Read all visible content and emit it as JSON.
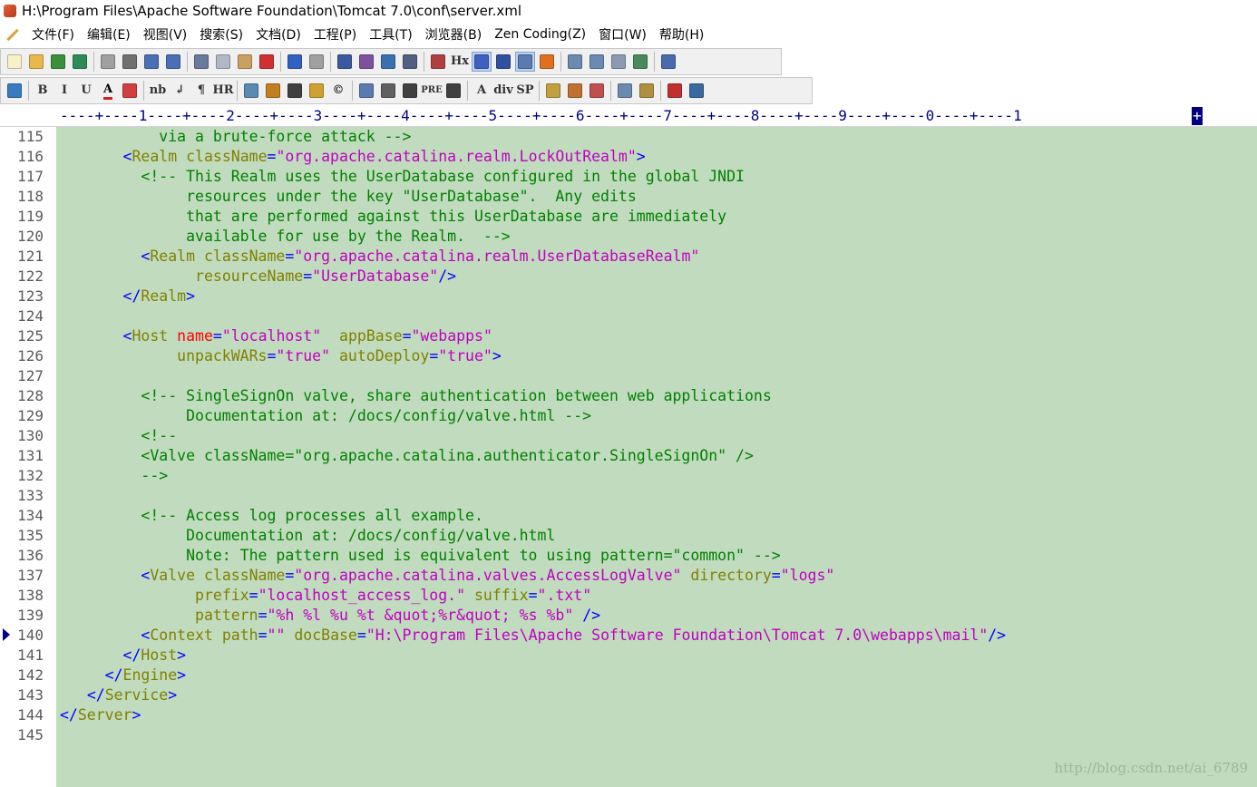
{
  "window": {
    "title": "H:\\Program Files\\Apache Software Foundation\\Tomcat 7.0\\conf\\server.xml"
  },
  "menu": [
    "文件(F)",
    "编辑(E)",
    "视图(V)",
    "搜索(S)",
    "文档(D)",
    "工程(P)",
    "工具(T)",
    "浏览器(B)",
    "Zen Coding(Z)",
    "窗口(W)",
    "帮助(H)"
  ],
  "toolbar1": [
    {
      "name": "new-file-icon",
      "color": "#f7f0c8"
    },
    {
      "name": "open-folder-icon",
      "color": "#e8b84a"
    },
    {
      "name": "save-icon",
      "color": "#3a8f3a"
    },
    {
      "name": "save-all-icon",
      "color": "#2e8b57"
    },
    {
      "sep": true
    },
    {
      "name": "print-preview-icon",
      "color": "#a0a0a0"
    },
    {
      "name": "print-icon",
      "color": "#707070"
    },
    {
      "name": "spellcheck-icon",
      "color": "#4a6fb5"
    },
    {
      "name": "refresh-icon",
      "color": "#4a6fb5"
    },
    {
      "sep": true
    },
    {
      "name": "cut-icon",
      "color": "#6a7a9a"
    },
    {
      "name": "copy-icon",
      "color": "#b0b8c8"
    },
    {
      "name": "paste-icon",
      "color": "#c8a060"
    },
    {
      "name": "delete-icon",
      "color": "#d03030"
    },
    {
      "sep": true
    },
    {
      "name": "undo-icon",
      "color": "#3060c0"
    },
    {
      "name": "redo-icon",
      "color": "#a0a0a0"
    },
    {
      "sep": true
    },
    {
      "name": "find-icon",
      "color": "#3a5aa0"
    },
    {
      "name": "replace-icon",
      "color": "#8050a0"
    },
    {
      "name": "goto-icon",
      "color": "#3a70b0"
    },
    {
      "name": "indent-icon",
      "color": "#506080"
    },
    {
      "sep": true
    },
    {
      "name": "font-size-icon",
      "color": "#b04040"
    },
    {
      "name": "heading-icon",
      "text": "Hx"
    },
    {
      "name": "word-wrap-icon",
      "color": "#4060c0",
      "active": true
    },
    {
      "name": "line-break-icon",
      "color": "#3050a0"
    },
    {
      "name": "line-numbers-icon",
      "color": "#5a7ab0",
      "active": true
    },
    {
      "name": "check-icon",
      "color": "#e07020"
    },
    {
      "sep": true
    },
    {
      "name": "panel-left-icon",
      "color": "#6a8ab0"
    },
    {
      "name": "panel-list-icon",
      "color": "#6a8ab0"
    },
    {
      "name": "panel-doc-icon",
      "color": "#8a9ab0"
    },
    {
      "name": "panel-window-icon",
      "color": "#4a8a5a"
    },
    {
      "sep": true
    },
    {
      "name": "help-icon",
      "color": "#4a6ab0"
    }
  ],
  "toolbar2": [
    {
      "name": "browser-icon",
      "color": "#3a7ac0"
    },
    {
      "sep": true
    },
    {
      "name": "bold-icon",
      "text": "B"
    },
    {
      "name": "italic-icon",
      "text": "I"
    },
    {
      "name": "underline-icon",
      "text": "U"
    },
    {
      "name": "font-color-icon",
      "text": "A"
    },
    {
      "name": "color-grid-icon",
      "color": "#d04040"
    },
    {
      "sep": true
    },
    {
      "name": "nbsp-icon",
      "text": "nb"
    },
    {
      "name": "br-icon",
      "text": "↲"
    },
    {
      "name": "paragraph-icon",
      "text": "¶"
    },
    {
      "name": "hr-icon",
      "text": "HR"
    },
    {
      "sep": true
    },
    {
      "name": "image-icon",
      "color": "#5a8ab0"
    },
    {
      "name": "anchor-icon",
      "color": "#c08020"
    },
    {
      "name": "hline-icon",
      "color": "#404040"
    },
    {
      "name": "edit-tag-icon",
      "color": "#d0a030"
    },
    {
      "name": "copyright-icon",
      "text": "©"
    },
    {
      "sep": true
    },
    {
      "name": "table-icon",
      "color": "#5a7ab0"
    },
    {
      "name": "form-icon",
      "color": "#606060"
    },
    {
      "name": "center-icon",
      "color": "#404040"
    },
    {
      "name": "pre-icon",
      "text": "PRE"
    },
    {
      "name": "list-icon",
      "color": "#404040"
    },
    {
      "sep": true
    },
    {
      "name": "font-tag-icon",
      "text": "A"
    },
    {
      "name": "div-icon",
      "text": "div"
    },
    {
      "name": "span-icon",
      "text": "SP"
    },
    {
      "sep": true
    },
    {
      "name": "note-icon",
      "color": "#c0a040"
    },
    {
      "name": "coffee-icon",
      "color": "#c07030"
    },
    {
      "name": "users-icon",
      "color": "#c05050"
    },
    {
      "sep": true
    },
    {
      "name": "layout-icon",
      "color": "#6a8ab0"
    },
    {
      "name": "layout-list-icon",
      "color": "#b09040"
    },
    {
      "sep": true
    },
    {
      "name": "color-picker-icon",
      "color": "#c03030"
    },
    {
      "name": "window-icon",
      "color": "#3a6aa0"
    }
  ],
  "ruler": "----+----1----+----2----+----3----+----4----+----5----+----6----+----7----+----8----+----9----+----0----+----1",
  "ruler_cursor": "+",
  "editor": {
    "line_numbers": [
      "115",
      "116",
      "117",
      "118",
      "119",
      "120",
      "121",
      "122",
      "123",
      "124",
      "125",
      "126",
      "127",
      "128",
      "129",
      "130",
      "131",
      "132",
      "133",
      "134",
      "135",
      "136",
      "137",
      "138",
      "139",
      "140",
      "141",
      "142",
      "143",
      "144",
      "145"
    ],
    "current_line": "140",
    "lines": [
      [
        [
          "           via a brute-force attack -->",
          "cm"
        ]
      ],
      [
        [
          "       ",
          ""
        ],
        [
          "<",
          "tag"
        ],
        [
          "Realm",
          "name"
        ],
        [
          " ",
          ""
        ],
        [
          "className",
          "attr"
        ],
        [
          "=",
          "tag"
        ],
        [
          "\"org.apache.catalina.realm.LockOutRealm\"",
          "val"
        ],
        [
          ">",
          "tag"
        ]
      ],
      [
        [
          "         <!-- This Realm uses the UserDatabase configured in the global JNDI",
          "cm"
        ]
      ],
      [
        [
          "              resources under the key \"UserDatabase\".  Any edits",
          "cm"
        ]
      ],
      [
        [
          "              that are performed against this UserDatabase are immediately",
          "cm"
        ]
      ],
      [
        [
          "              available for use by the Realm.  -->",
          "cm"
        ]
      ],
      [
        [
          "         ",
          ""
        ],
        [
          "<",
          "tag"
        ],
        [
          "Realm",
          "name"
        ],
        [
          " ",
          ""
        ],
        [
          "className",
          "attr"
        ],
        [
          "=",
          "tag"
        ],
        [
          "\"org.apache.catalina.realm.UserDatabaseRealm\"",
          "val"
        ]
      ],
      [
        [
          "               ",
          ""
        ],
        [
          "resourceName",
          "attr"
        ],
        [
          "=",
          "tag"
        ],
        [
          "\"UserDatabase\"",
          "val"
        ],
        [
          "/>",
          "tag"
        ]
      ],
      [
        [
          "       ",
          ""
        ],
        [
          "</",
          "tag"
        ],
        [
          "Realm",
          "name"
        ],
        [
          ">",
          "tag"
        ]
      ],
      [
        [
          "",
          ""
        ]
      ],
      [
        [
          "       ",
          ""
        ],
        [
          "<",
          "tag"
        ],
        [
          "Host",
          "name"
        ],
        [
          " ",
          ""
        ],
        [
          "name",
          "red"
        ],
        [
          "=",
          "tag"
        ],
        [
          "\"localhost\"",
          "val"
        ],
        [
          "  ",
          ""
        ],
        [
          "appBase",
          "attr"
        ],
        [
          "=",
          "tag"
        ],
        [
          "\"webapps\"",
          "val"
        ]
      ],
      [
        [
          "             ",
          ""
        ],
        [
          "unpackWARs",
          "attr"
        ],
        [
          "=",
          "tag"
        ],
        [
          "\"true\"",
          "val"
        ],
        [
          " ",
          ""
        ],
        [
          "autoDeploy",
          "attr"
        ],
        [
          "=",
          "tag"
        ],
        [
          "\"true\"",
          "val"
        ],
        [
          ">",
          "tag"
        ]
      ],
      [
        [
          "",
          ""
        ]
      ],
      [
        [
          "         <!-- SingleSignOn valve, share authentication between web applications",
          "cm"
        ]
      ],
      [
        [
          "              Documentation at: /docs/config/valve.html -->",
          "cm"
        ]
      ],
      [
        [
          "         <!--",
          "cm"
        ]
      ],
      [
        [
          "         <Valve className=\"org.apache.catalina.authenticator.SingleSignOn\" />",
          "cm"
        ]
      ],
      [
        [
          "         -->",
          "cm"
        ]
      ],
      [
        [
          "",
          ""
        ]
      ],
      [
        [
          "         <!-- Access log processes all example.",
          "cm"
        ]
      ],
      [
        [
          "              Documentation at: /docs/config/valve.html",
          "cm"
        ]
      ],
      [
        [
          "              Note: The pattern used is equivalent to using pattern=\"common\" -->",
          "cm"
        ]
      ],
      [
        [
          "         ",
          ""
        ],
        [
          "<",
          "tag"
        ],
        [
          "Valve",
          "name"
        ],
        [
          " ",
          ""
        ],
        [
          "className",
          "attr"
        ],
        [
          "=",
          "tag"
        ],
        [
          "\"org.apache.catalina.valves.AccessLogValve\"",
          "val"
        ],
        [
          " ",
          ""
        ],
        [
          "directory",
          "attr"
        ],
        [
          "=",
          "tag"
        ],
        [
          "\"logs\"",
          "val"
        ]
      ],
      [
        [
          "               ",
          ""
        ],
        [
          "prefix",
          "attr"
        ],
        [
          "=",
          "tag"
        ],
        [
          "\"localhost_access_log.\"",
          "val"
        ],
        [
          " ",
          ""
        ],
        [
          "suffix",
          "attr"
        ],
        [
          "=",
          "tag"
        ],
        [
          "\".txt\"",
          "val"
        ]
      ],
      [
        [
          "               ",
          ""
        ],
        [
          "pattern",
          "attr"
        ],
        [
          "=",
          "tag"
        ],
        [
          "\"%h %l %u %t &quot;%r&quot; %s %b\"",
          "val"
        ],
        [
          " ",
          ""
        ],
        [
          "/>",
          "tag"
        ]
      ],
      [
        [
          "         ",
          ""
        ],
        [
          "<",
          "tag"
        ],
        [
          "Context",
          "name"
        ],
        [
          " ",
          ""
        ],
        [
          "path",
          "attr"
        ],
        [
          "=",
          "tag"
        ],
        [
          "\"\"",
          "val"
        ],
        [
          " ",
          ""
        ],
        [
          "docBase",
          "attr"
        ],
        [
          "=",
          "tag"
        ],
        [
          "\"H:\\Program Files\\Apache Software Foundation\\Tomcat 7.0\\webapps\\mail\"",
          "val"
        ],
        [
          "/>",
          "tag"
        ]
      ],
      [
        [
          "       ",
          ""
        ],
        [
          "</",
          "tag"
        ],
        [
          "Host",
          "name"
        ],
        [
          ">",
          "tag"
        ]
      ],
      [
        [
          "     ",
          ""
        ],
        [
          "</",
          "tag"
        ],
        [
          "Engine",
          "name"
        ],
        [
          ">",
          "tag"
        ]
      ],
      [
        [
          "   ",
          ""
        ],
        [
          "</",
          "tag"
        ],
        [
          "Service",
          "name"
        ],
        [
          ">",
          "tag"
        ]
      ],
      [
        [
          "",
          ""
        ],
        [
          "</",
          "tag"
        ],
        [
          "Server",
          "name"
        ],
        [
          ">",
          "tag"
        ]
      ],
      [
        [
          "",
          ""
        ]
      ]
    ]
  },
  "watermark": "http://blog.csdn.net/ai_6789"
}
